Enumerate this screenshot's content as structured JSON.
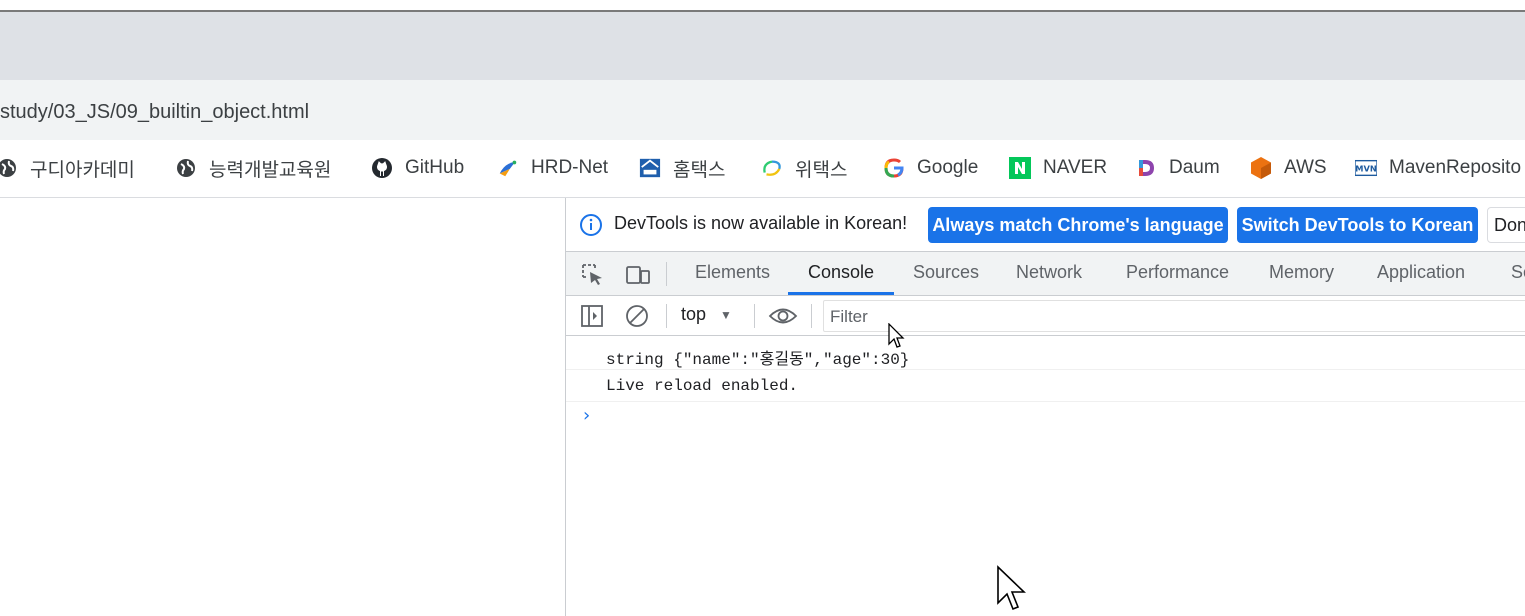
{
  "browser": {
    "url": "study/03_JS/09_builtin_object.html",
    "bookmarks": [
      {
        "label": "구디아카데미",
        "icon": "globe-icon"
      },
      {
        "label": "능력개발교육원",
        "icon": "globe-icon"
      },
      {
        "label": "GitHub",
        "icon": "github-icon"
      },
      {
        "label": "HRD-Net",
        "icon": "hrdnet-icon"
      },
      {
        "label": "홈택스",
        "icon": "hometax-icon"
      },
      {
        "label": "위택스",
        "icon": "wetax-icon"
      },
      {
        "label": "Google",
        "icon": "google-icon"
      },
      {
        "label": "NAVER",
        "icon": "naver-icon"
      },
      {
        "label": "Daum",
        "icon": "daum-icon"
      },
      {
        "label": "AWS",
        "icon": "aws-icon"
      },
      {
        "label": "MavenReposito",
        "icon": "maven-icon"
      }
    ]
  },
  "devtools": {
    "infobar": {
      "message": "DevTools is now available in Korean!",
      "primary_button": "Always match Chrome's language",
      "secondary_button": "Switch DevTools to Korean",
      "dismiss_button": "Don"
    },
    "tabs": [
      "Elements",
      "Console",
      "Sources",
      "Network",
      "Performance",
      "Memory",
      "Application",
      "Se"
    ],
    "active_tab": "Console",
    "console": {
      "context": "top",
      "filter_placeholder": "Filter",
      "messages": [
        "string {\"name\":\"홍길동\",\"age\":30}",
        "Live reload enabled."
      ],
      "prompt": "›"
    }
  },
  "colors": {
    "accent": "#1a73e8",
    "tab_strip": "#dee1e6",
    "toolbar": "#f1f3f4"
  }
}
